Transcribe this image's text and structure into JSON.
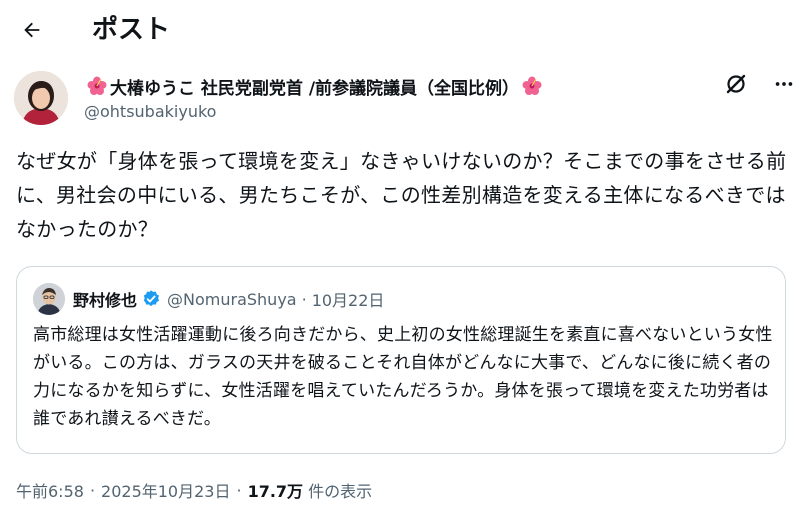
{
  "header": {
    "title": "ポスト",
    "back_icon": "arrow-left-icon"
  },
  "author": {
    "name": "大椿ゆうこ 社民党副党首 /前参議院議員（全国比例）",
    "handle": "@ohtsubakiyuko",
    "name_emoji": "hibiscus-icon"
  },
  "post": {
    "text": "なぜ女が「身体を張って環境を変え」なきゃいけないのか？そこまでの事をさせる前に、男社会の中にいる、男たちこそが、この性差別構造を変える主体になるべきではなかったのか？"
  },
  "quote": {
    "name": "野村修也",
    "handle": "@NomuraShuya",
    "dot": "·",
    "date": "10月22日",
    "text": "高市総理は女性活躍運動に後ろ向きだから、史上初の女性総理誕生を素直に喜べないという女性がいる。この方は、ガラスの天井を破ることそれ自体がどんなに大事で、どんなに後に続く者の力になるかを知らずに、女性活躍を唱えていたんだろうか。身体を張って環境を変えた功労者は誰であれ讃えるべきだ。"
  },
  "meta": {
    "time": "午前6:58",
    "date": "2025年10月23日",
    "sep1": "·",
    "sep2": "·",
    "views_count": "17.7万",
    "views_label": "件の表示"
  },
  "colors": {
    "verified": "#1d9bf0",
    "secondary_text": "#536471",
    "border": "#cfd9de"
  }
}
